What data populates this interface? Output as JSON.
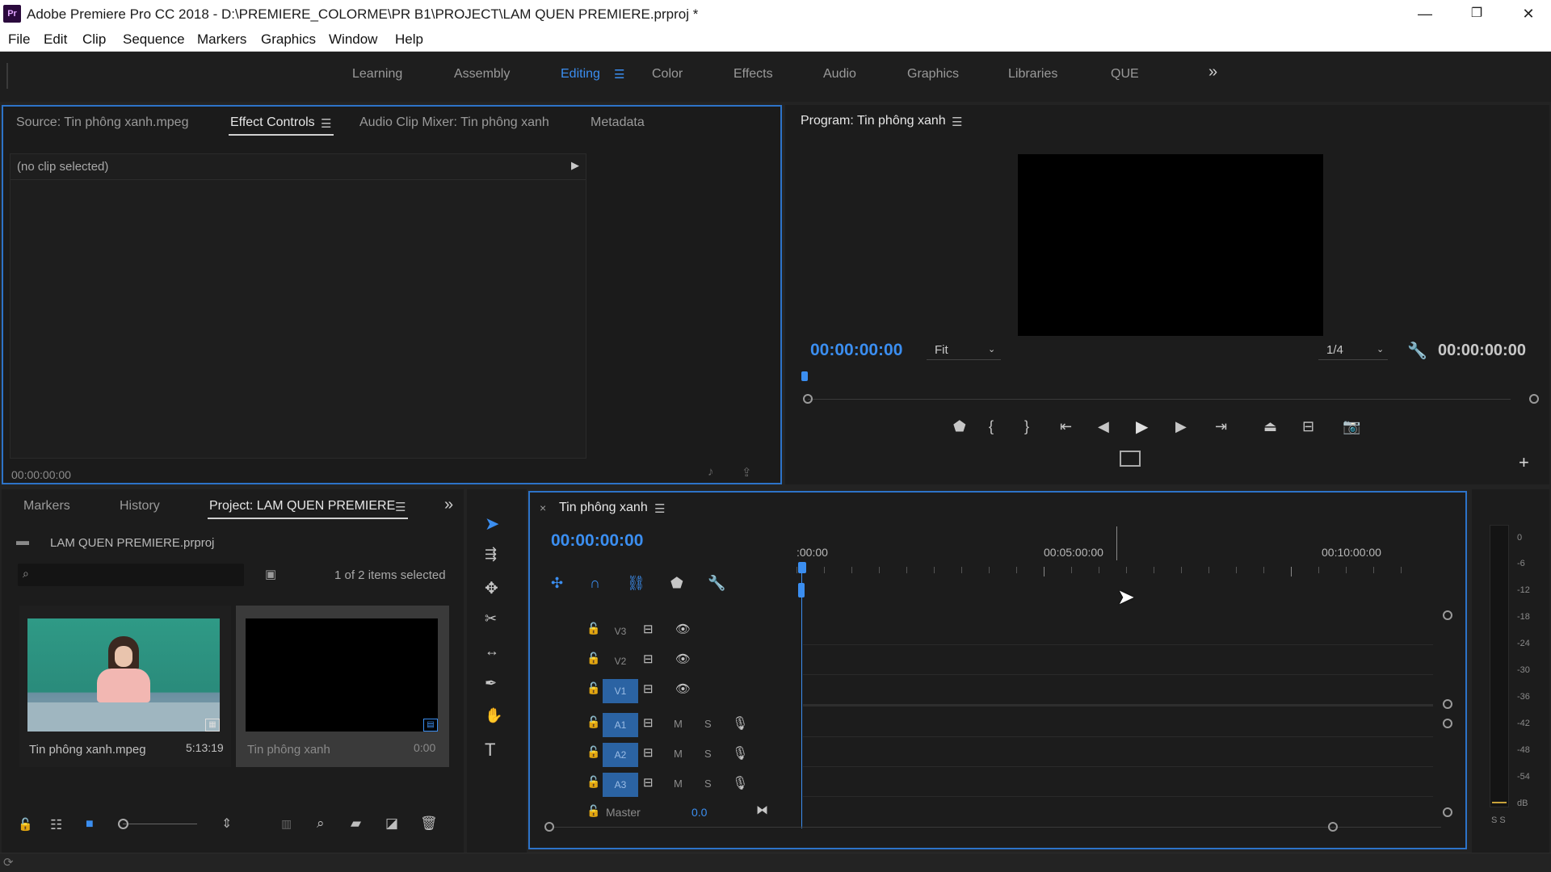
{
  "window": {
    "logo_text": "Pr",
    "title": "Adobe Premiere Pro CC 2018 - D:\\PREMIERE_COLORME\\PR B1\\PROJECT\\LAM QUEN PREMIERE.prproj *",
    "minimize": "—",
    "restore": "❐",
    "close": "✕"
  },
  "menu": [
    "File",
    "Edit",
    "Clip",
    "Sequence",
    "Markers",
    "Graphics",
    "Window",
    "Help"
  ],
  "workspaces": {
    "tabs": [
      "Learning",
      "Assembly",
      "Editing",
      "Color",
      "Effects",
      "Audio",
      "Graphics",
      "Libraries",
      "QUE"
    ],
    "active": "Editing",
    "more": "»"
  },
  "source_panel": {
    "tabs": [
      "Source: Tin phông xanh.mpeg",
      "Effect Controls",
      "Audio Clip Mixer: Tin phông xanh",
      "Metadata"
    ],
    "active": "Effect Controls",
    "no_clip": "(no clip selected)",
    "timecode": "00:00:00:00"
  },
  "program_monitor": {
    "title": "Program: Tin phông xanh",
    "timecode_current": "00:00:00:00",
    "zoom": "Fit",
    "resolution": "1/4",
    "timecode_duration": "00:00:00:00"
  },
  "project_panel": {
    "tabs": [
      "Markers",
      "History",
      "Project: LAM QUEN PREMIERE"
    ],
    "active": "Project: LAM QUEN PREMIERE",
    "more": "»",
    "project_file": "LAM QUEN PREMIERE.prproj",
    "search_placeholder": "",
    "selection_status": "1 of 2 items selected",
    "items": [
      {
        "name": "Tin phông xanh.mpeg",
        "duration": "5:13:19"
      },
      {
        "name": "Tin phông xanh",
        "duration": "0:00"
      }
    ]
  },
  "timeline": {
    "close": "×",
    "sequence_name": "Tin phông xanh",
    "timecode": "00:00:00:00",
    "ruler_labels": [
      ":00:00",
      "00:05:00:00",
      "00:10:00:00"
    ],
    "video_tracks": [
      "V3",
      "V2",
      "V1"
    ],
    "audio_tracks": [
      "A1",
      "A2",
      "A3"
    ],
    "mute_label": "M",
    "solo_label": "S",
    "master_label": "Master",
    "master_value": "0.0"
  },
  "audio_meter": {
    "scale": [
      "0",
      "-6",
      "-12",
      "-18",
      "-24",
      "-30",
      "-36",
      "-42",
      "-48",
      "-54",
      "dB"
    ],
    "solo_labels": "S S"
  },
  "colors": {
    "accent_blue": "#3b8ef0",
    "panel_bg": "#1b1b1b",
    "active_track": "#2b63a3"
  }
}
